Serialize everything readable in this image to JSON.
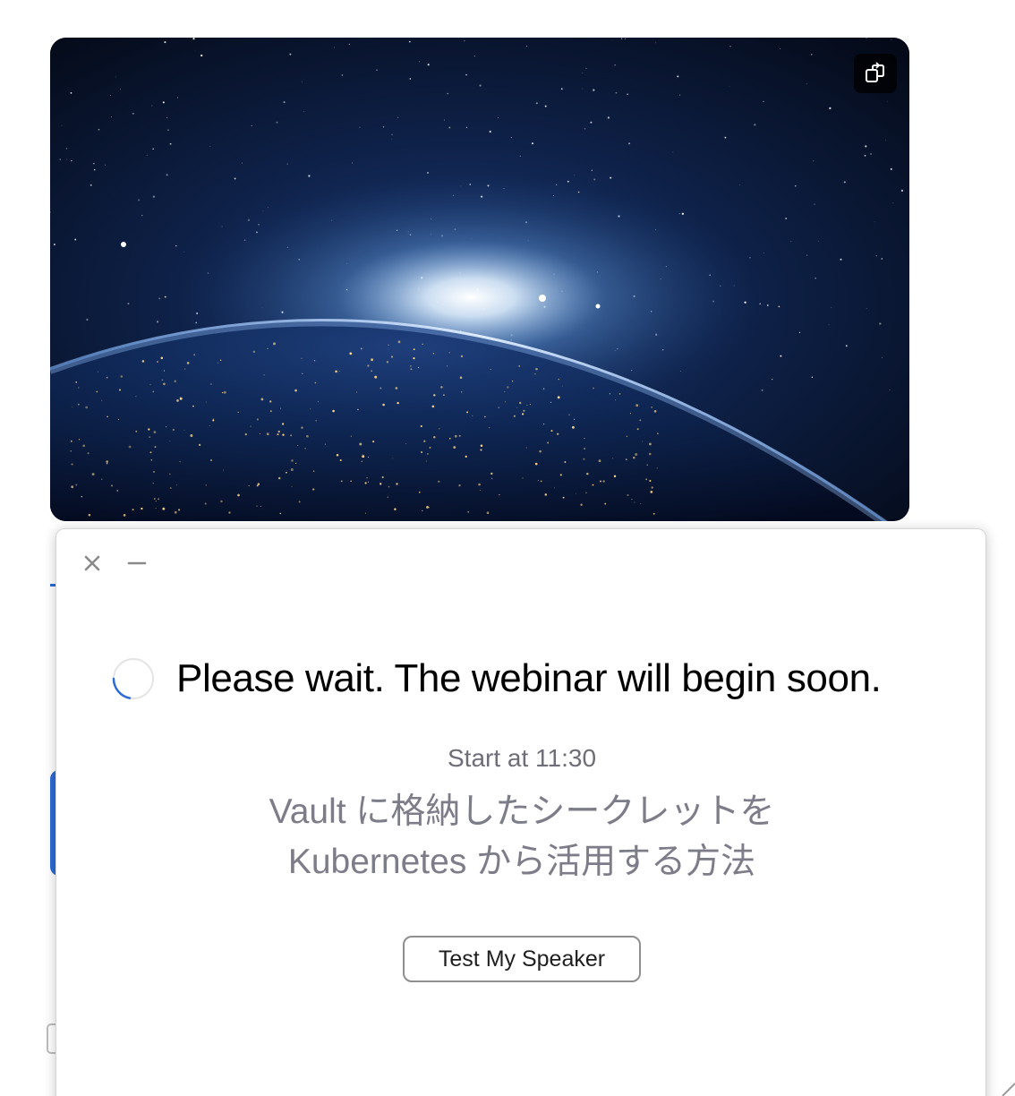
{
  "hero": {
    "expand_icon": "expand-window-icon"
  },
  "dialog": {
    "close_icon": "close-icon",
    "minimize_icon": "minimize-icon",
    "spinner_icon": "loading-spinner-icon",
    "headline": "Please wait. The webinar will begin soon.",
    "start_time": "Start at 11:30",
    "topic_line1": "Vault に格納したシークレットを",
    "topic_line2": "Kubernetes から活用する方法",
    "test_speaker_button": "Test My Speaker"
  },
  "colors": {
    "accent": "#2d6bd6",
    "headline": "#000000",
    "subtitle": "#6e6e78",
    "topic": "#7d7d8a",
    "button_border": "#8f8f8f"
  }
}
